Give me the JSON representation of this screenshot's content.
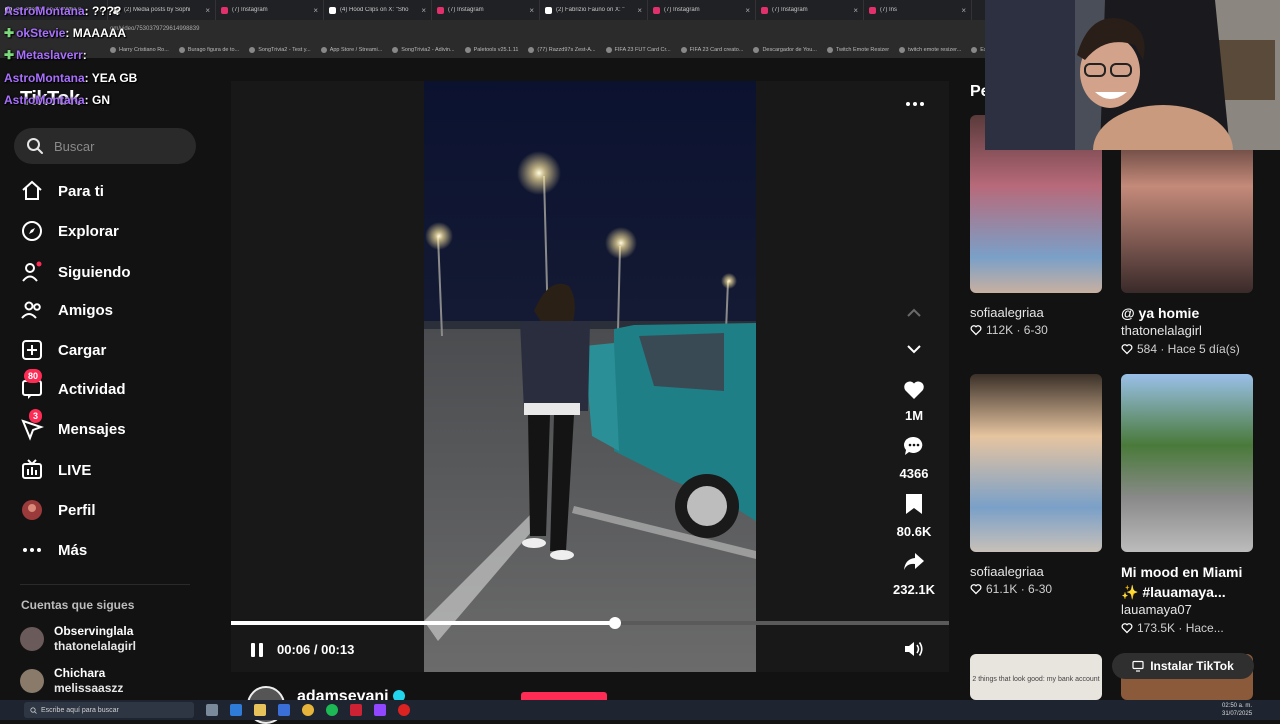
{
  "browser": {
    "tabs": [
      {
        "label": "(6) ottaboy on X: \"Who n",
        "color": "#ffffff"
      },
      {
        "label": "(2) Media posts by Sophi",
        "color": "#ffffff"
      },
      {
        "label": "(7) Instagram",
        "color": "#e1306c"
      },
      {
        "label": "(4) Hood Clips on X: \"Sho",
        "color": "#ffffff"
      },
      {
        "label": "(7) Instagram",
        "color": "#e1306c"
      },
      {
        "label": "(2) Fabrizio Fauno on X: \"",
        "color": "#ffffff"
      },
      {
        "label": "(7) Instagram",
        "color": "#e1306c"
      },
      {
        "label": "(7) Instagram",
        "color": "#e1306c"
      },
      {
        "label": "(7) Ins",
        "color": "#e1306c"
      }
    ],
    "url": "om/video/7530379729614998839",
    "bookmarks": [
      "Harry Cristiano Ro...",
      "Burago figura de to...",
      "SongTrivia2 - Test y...",
      "App Store / Streami...",
      "SongTrivia2 - Adivin...",
      "Paletools v25.1.11",
      "(77) Razzd97s Zest-A...",
      "FIFA 23 FUT Card Cr...",
      "FIFA 23 Card creato...",
      "Descargador de You...",
      "Twitch Emote Resizer",
      "twitch emote resizer...",
      "Estadio Pri..."
    ]
  },
  "chat": [
    {
      "user": "AstroMontana",
      "msg": ": ????",
      "badge": ""
    },
    {
      "user": "okStevie",
      "msg": ": MAAAAA",
      "badge": "✚"
    },
    {
      "user": "Metaslaverr",
      "msg": ":",
      "badge": "✚"
    },
    {
      "user": "AstroMontana",
      "msg": ": YEA GB",
      "badge": ""
    },
    {
      "user": "AstroMontana",
      "msg": ": GN",
      "badge": ""
    }
  ],
  "sidebar": {
    "logo": "TikTok",
    "search_placeholder": "Buscar",
    "items": [
      {
        "label": "Para ti",
        "icon": "home-icon"
      },
      {
        "label": "Explorar",
        "icon": "compass-icon"
      },
      {
        "label": "Siguiendo",
        "icon": "user-follow-icon"
      },
      {
        "label": "Amigos",
        "icon": "friends-icon"
      },
      {
        "label": "Cargar",
        "icon": "upload-icon"
      },
      {
        "label": "Actividad",
        "icon": "activity-icon",
        "badge": "80"
      },
      {
        "label": "Mensajes",
        "icon": "messages-icon",
        "badge": "3"
      },
      {
        "label": "LIVE",
        "icon": "live-icon"
      },
      {
        "label": "Perfil",
        "icon": "profile-icon"
      },
      {
        "label": "Más",
        "icon": "more-icon"
      }
    ],
    "following_title": "Cuentas que sigues",
    "following": [
      {
        "name": "Observinglala",
        "handle": "thatonelalagirl"
      },
      {
        "name": "Chichara",
        "handle": "melissaaszz"
      }
    ]
  },
  "player": {
    "time": "00:06 / 00:13",
    "progress": 0.535,
    "likes": "1M",
    "comments": "4366",
    "saves": "80.6K",
    "shares": "232.1K",
    "author": "adamsevani"
  },
  "right": {
    "title": "Pe",
    "cards": [
      {
        "title": "sofiaalegriaa",
        "bold": false,
        "sub": "",
        "meta": "112K · 6-30"
      },
      {
        "title": "@ ya homie",
        "bold": true,
        "sub": "thatonelalagirl",
        "meta": "584 · Hace 5 día(s)"
      },
      {
        "title": "sofiaalegriaa",
        "bold": false,
        "sub": "",
        "meta": "61.1K · 6-30"
      },
      {
        "title": "Mi mood en Miami ✨ #lauamaya...",
        "bold": true,
        "sub": "lauamaya07",
        "meta": "173.5K · Hace..."
      }
    ],
    "thumb_caption": "2 things that look good: my bank account",
    "install": "Instalar TikTok"
  },
  "taskbar": {
    "search": "Escribe aquí para buscar",
    "time": "02:50 a. m.",
    "date": "31/07/2025"
  },
  "colors": {
    "accent": "#fe2c55",
    "chat_user": "#a970ff"
  }
}
